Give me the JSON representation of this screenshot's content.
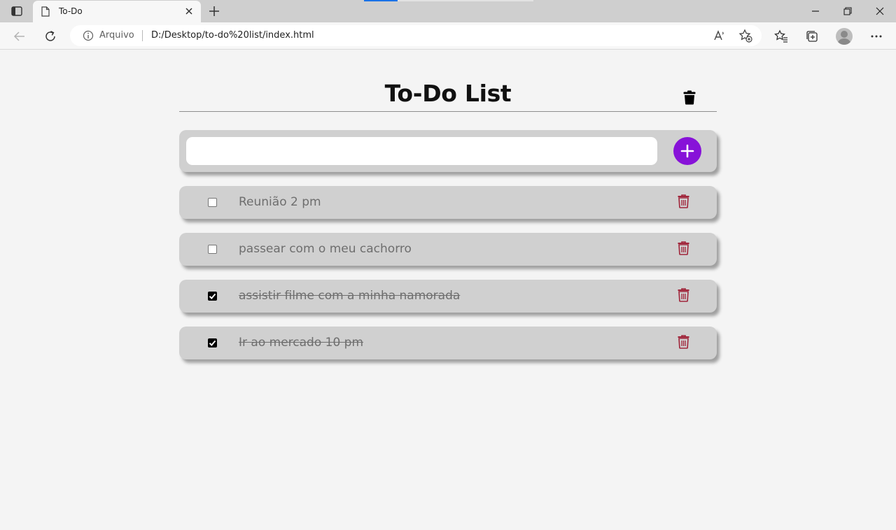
{
  "browser": {
    "tab_title": "To-Do",
    "security_label": "Arquivo",
    "url": "D:/Desktop/to-do%20list/index.html"
  },
  "page": {
    "title": "To-Do List",
    "input": {
      "value": "",
      "placeholder": ""
    }
  },
  "tasks": [
    {
      "text": "Reunião 2 pm",
      "done": false
    },
    {
      "text": "passear com o meu cachorro",
      "done": false
    },
    {
      "text": "assistir filme com a minha namorada",
      "done": true
    },
    {
      "text": "Ir ao mercado 10 pm",
      "done": true
    }
  ],
  "colors": {
    "accent": "#8712d8",
    "delete_icon": "#a0253a",
    "card_bg": "#d0d0d0",
    "page_bg": "#f4f4f4"
  },
  "icons": {
    "clear_all": "trash-icon",
    "add": "plus-icon",
    "task_delete": "trash-outline-icon"
  }
}
